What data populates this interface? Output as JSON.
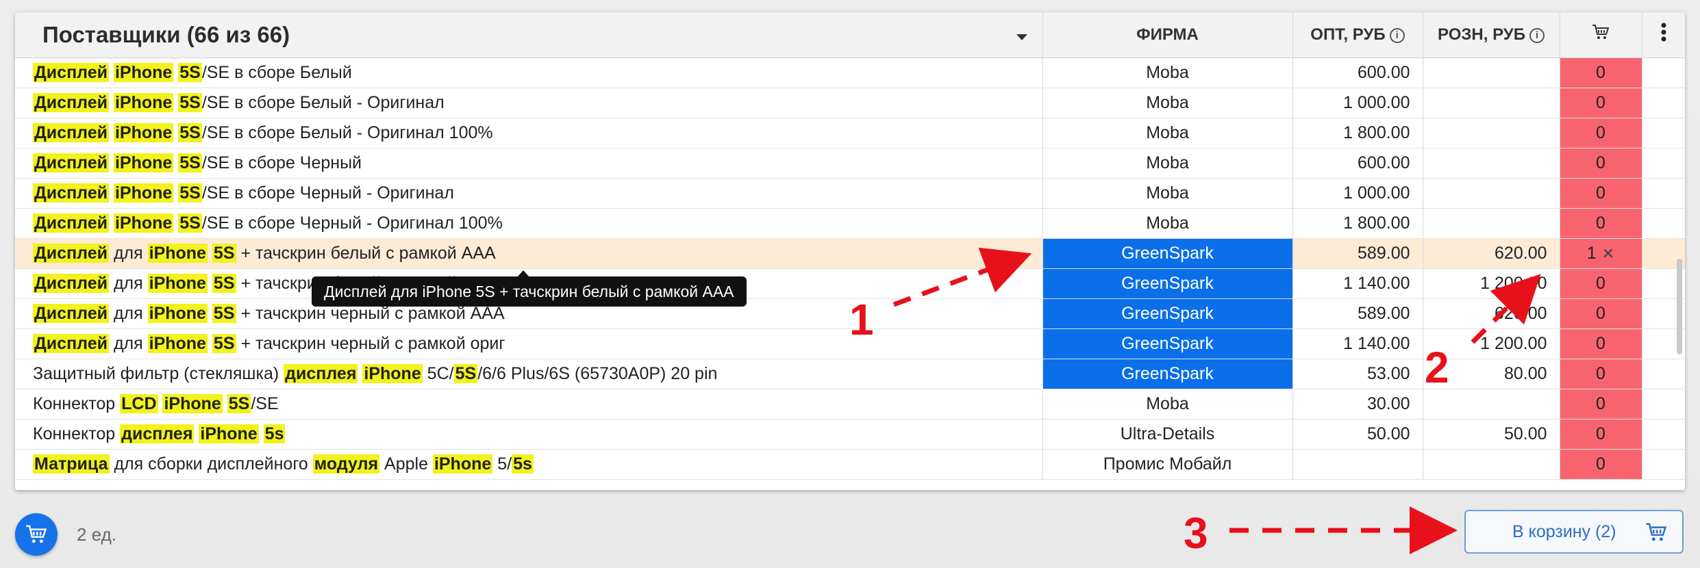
{
  "header": {
    "title": "Поставщики (66 из 66)",
    "firm": "ФИРМА",
    "opt": "ОПТ, РУБ",
    "rozn": "РОЗН, РУБ",
    "info_glyph": "i"
  },
  "rows": [
    {
      "name": [
        [
          "Дисплей",
          true
        ],
        [
          " ",
          false
        ],
        [
          "iPhone",
          true
        ],
        [
          " ",
          false
        ],
        [
          "5S",
          true
        ],
        [
          "/SE в сборе Белый",
          false
        ]
      ],
      "firm": "Moba",
      "opt": "600.00",
      "rozn": "",
      "cart": "0",
      "gs": false
    },
    {
      "name": [
        [
          "Дисплей",
          true
        ],
        [
          " ",
          false
        ],
        [
          "iPhone",
          true
        ],
        [
          " ",
          false
        ],
        [
          "5S",
          true
        ],
        [
          "/SE в сборе Белый - Оригинал",
          false
        ]
      ],
      "firm": "Moba",
      "opt": "1 000.00",
      "rozn": "",
      "cart": "0",
      "gs": false
    },
    {
      "name": [
        [
          "Дисплей",
          true
        ],
        [
          " ",
          false
        ],
        [
          "iPhone",
          true
        ],
        [
          " ",
          false
        ],
        [
          "5S",
          true
        ],
        [
          "/SE в сборе Белый - Оригинал 100%",
          false
        ]
      ],
      "firm": "Moba",
      "opt": "1 800.00",
      "rozn": "",
      "cart": "0",
      "gs": false
    },
    {
      "name": [
        [
          "Дисплей",
          true
        ],
        [
          " ",
          false
        ],
        [
          "iPhone",
          true
        ],
        [
          " ",
          false
        ],
        [
          "5S",
          true
        ],
        [
          "/SE в сборе Черный",
          false
        ]
      ],
      "firm": "Moba",
      "opt": "600.00",
      "rozn": "",
      "cart": "0",
      "gs": false
    },
    {
      "name": [
        [
          "Дисплей",
          true
        ],
        [
          " ",
          false
        ],
        [
          "iPhone",
          true
        ],
        [
          " ",
          false
        ],
        [
          "5S",
          true
        ],
        [
          "/SE в сборе Черный - Оригинал",
          false
        ]
      ],
      "firm": "Moba",
      "opt": "1 000.00",
      "rozn": "",
      "cart": "0",
      "gs": false
    },
    {
      "name": [
        [
          "Дисплей",
          true
        ],
        [
          " ",
          false
        ],
        [
          "iPhone",
          true
        ],
        [
          " ",
          false
        ],
        [
          "5S",
          true
        ],
        [
          "/SE в сборе Черный - Оригинал 100%",
          false
        ]
      ],
      "firm": "Moba",
      "opt": "1 800.00",
      "rozn": "",
      "cart": "0",
      "gs": false
    },
    {
      "name": [
        [
          "Дисплей",
          true
        ],
        [
          " для ",
          false
        ],
        [
          "iPhone",
          true
        ],
        [
          " ",
          false
        ],
        [
          "5S",
          true
        ],
        [
          " + тачскрин белый с рамкой AAA",
          false
        ]
      ],
      "firm": "GreenSpark",
      "opt": "589.00",
      "rozn": "620.00",
      "cart": "1",
      "gs": true,
      "selected": true
    },
    {
      "name": [
        [
          "Дисплей",
          true
        ],
        [
          " для ",
          false
        ],
        [
          "iPhone",
          true
        ],
        [
          " ",
          false
        ],
        [
          "5S",
          true
        ],
        [
          " + тачскрин белый с рамкой ориг",
          false
        ]
      ],
      "firm": "GreenSpark",
      "opt": "1 140.00",
      "rozn": "1 200.00",
      "cart": "0",
      "gs": true
    },
    {
      "name": [
        [
          "Дисплей",
          true
        ],
        [
          " для ",
          false
        ],
        [
          "iPhone",
          true
        ],
        [
          " ",
          false
        ],
        [
          "5S",
          true
        ],
        [
          " + тачскрин черный с рамкой AAA",
          false
        ]
      ],
      "firm": "GreenSpark",
      "opt": "589.00",
      "rozn": "620.00",
      "cart": "0",
      "gs": true
    },
    {
      "name": [
        [
          "Дисплей",
          true
        ],
        [
          " для ",
          false
        ],
        [
          "iPhone",
          true
        ],
        [
          " ",
          false
        ],
        [
          "5S",
          true
        ],
        [
          " + тачскрин черный с рамкой ориг",
          false
        ]
      ],
      "firm": "GreenSpark",
      "opt": "1 140.00",
      "rozn": "1 200.00",
      "cart": "0",
      "gs": true
    },
    {
      "name": [
        [
          "Защитный фильтр (стекляшка) ",
          false
        ],
        [
          "дисплея",
          true
        ],
        [
          " ",
          false
        ],
        [
          "iPhone",
          true
        ],
        [
          " 5C/",
          false
        ],
        [
          "5S",
          true
        ],
        [
          "/6/6 Plus/6S (65730A0P) 20 pin",
          false
        ]
      ],
      "firm": "GreenSpark",
      "opt": "53.00",
      "rozn": "80.00",
      "cart": "0",
      "gs": true
    },
    {
      "name": [
        [
          "Коннектор ",
          false
        ],
        [
          "LCD",
          true
        ],
        [
          " ",
          false
        ],
        [
          "iPhone",
          true
        ],
        [
          " ",
          false
        ],
        [
          "5S",
          true
        ],
        [
          "/SE",
          false
        ]
      ],
      "firm": "Moba",
      "opt": "30.00",
      "rozn": "",
      "cart": "0",
      "gs": false
    },
    {
      "name": [
        [
          "Коннектор ",
          false
        ],
        [
          "дисплея",
          true
        ],
        [
          " ",
          false
        ],
        [
          "iPhone",
          true
        ],
        [
          " ",
          false
        ],
        [
          "5s",
          true
        ]
      ],
      "firm": "Ultra-Details",
      "opt": "50.00",
      "rozn": "50.00",
      "cart": "0",
      "gs": false
    },
    {
      "name": [
        [
          "Матрица",
          true
        ],
        [
          " для сборки дисплейного ",
          false
        ],
        [
          "модуля",
          true
        ],
        [
          " Apple ",
          false
        ],
        [
          "iPhone",
          true
        ],
        [
          " 5/",
          false
        ],
        [
          "5s",
          true
        ]
      ],
      "firm": "Промис Мобайл",
      "opt": "",
      "rozn": "",
      "cart": "0",
      "gs": false
    }
  ],
  "tooltip": "Дисплей для iPhone 5S + тачскрин белый с рамкой AAA",
  "footer": {
    "units": "2 ед.",
    "to_cart": "В корзину (2)"
  },
  "annotations": {
    "n1": "1",
    "n2": "2",
    "n3": "3",
    "color": "#e8101a"
  },
  "colors": {
    "greenspark_bg": "#0a6fe8",
    "cart_cell_bg": "#f76470",
    "highlight": "#f2f21c",
    "selected_row": "#fdebd6"
  },
  "icons": {
    "cart": "cart-icon",
    "more": "more-vertical-icon",
    "close": "close-icon"
  }
}
